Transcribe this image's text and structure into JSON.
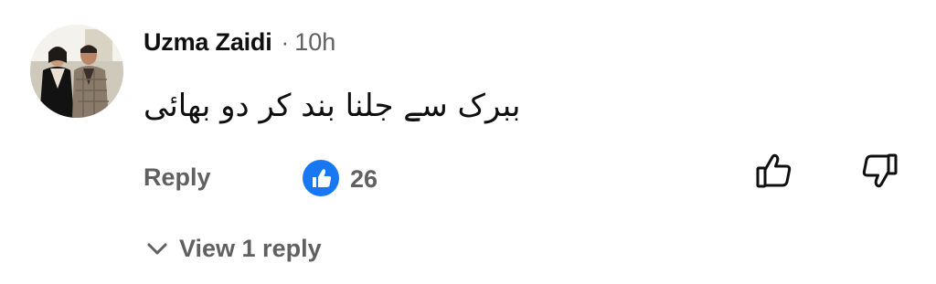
{
  "comment": {
    "author": "Uzma Zaidi",
    "separator": "·",
    "time": "10h",
    "text": "ببرک سے جلنا بند کر دو بھائی",
    "avatar_icon": "avatar-photo"
  },
  "actions": {
    "reply_label": "Reply",
    "like_count": "26",
    "like_badge_color": "#1877f2",
    "thumb_up_icon": "thumb-up-icon",
    "thumb_down_icon": "thumb-down-icon"
  },
  "replies": {
    "view_label": "View 1 reply",
    "chevron_icon": "chevron-down-icon"
  }
}
